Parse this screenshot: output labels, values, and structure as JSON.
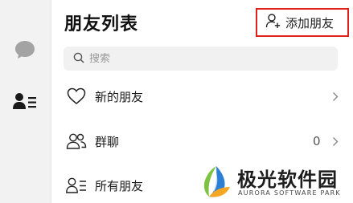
{
  "rail": {
    "items": [
      {
        "icon": "chat-bubble-icon"
      },
      {
        "icon": "contacts-list-icon",
        "active": true
      }
    ]
  },
  "header": {
    "title": "朋友列表",
    "add_friend_label": "添加朋友",
    "add_friend_icon": "add-person-icon"
  },
  "search": {
    "placeholder": "搜索",
    "value": ""
  },
  "list": {
    "items": [
      {
        "label": "新的朋友",
        "icon": "heart-icon",
        "count": ""
      },
      {
        "label": "群聊",
        "icon": "group-icon",
        "count": "0"
      },
      {
        "label": "所有朋友",
        "icon": "contacts-list-icon",
        "count": ""
      }
    ]
  },
  "watermark": {
    "title": "极光软件园",
    "subtitle": "AURORA SOFTWARE PARK"
  },
  "colors": {
    "rail_bg": "#f2f2f2",
    "highlight_border": "#e0201b",
    "search_bg": "#f1f1f1"
  }
}
